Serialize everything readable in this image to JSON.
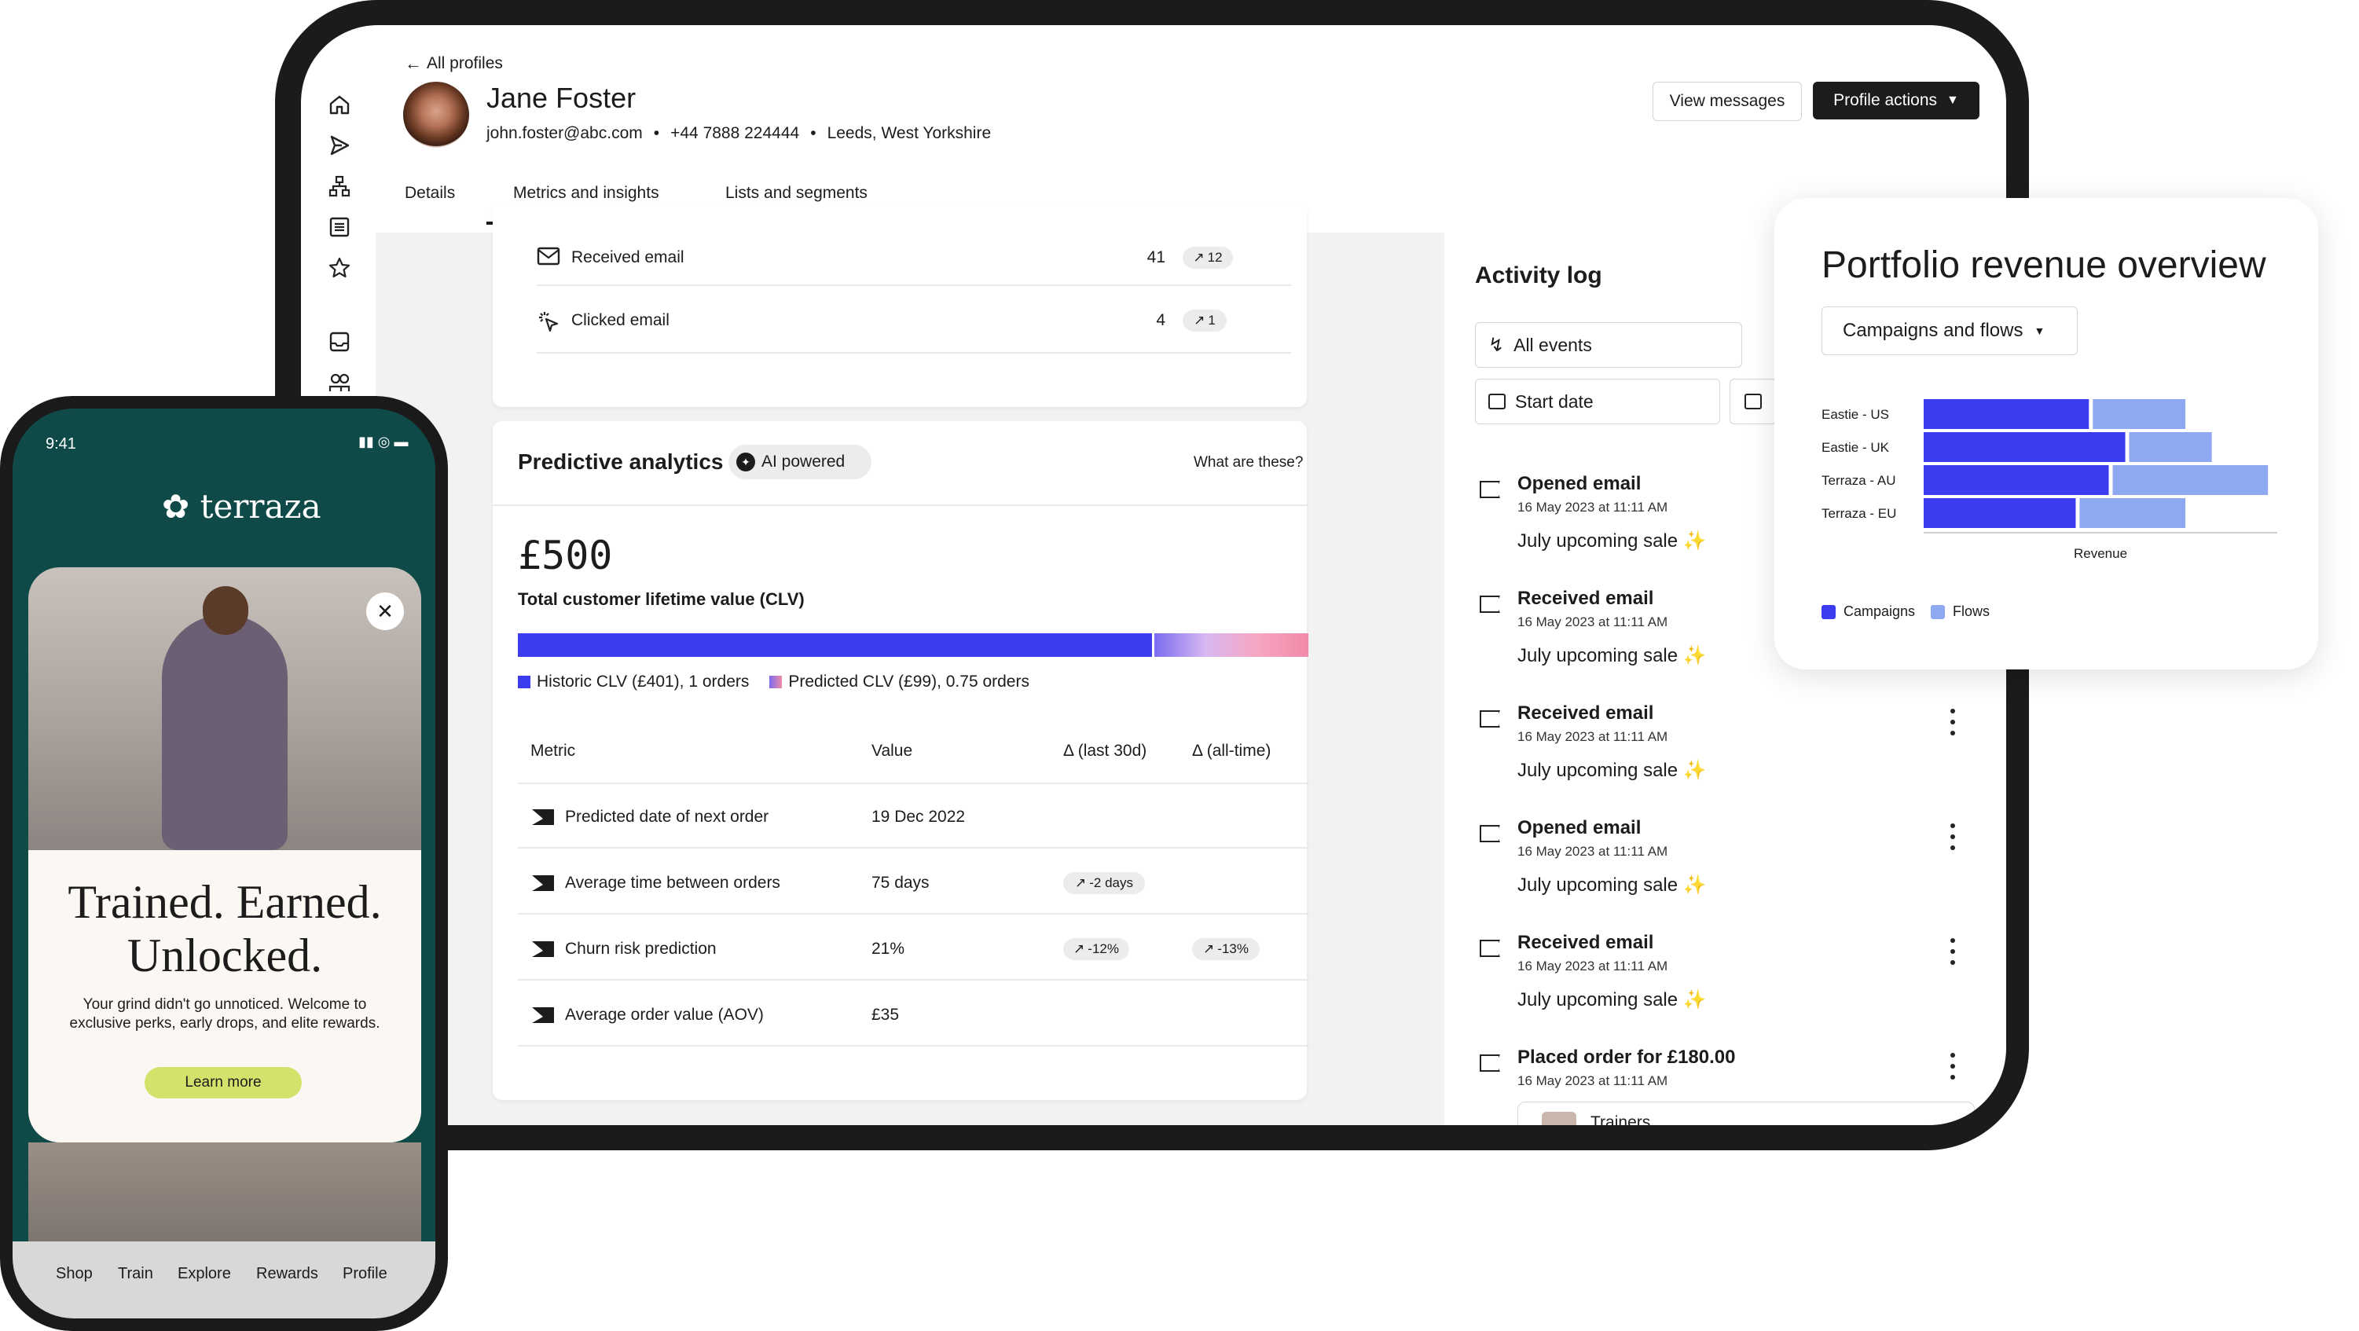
{
  "profile": {
    "back_label": "All profiles",
    "name": "Jane Foster",
    "email": "john.foster@abc.com",
    "phone": "+44 7888 224444",
    "location": "Leeds, West Yorkshire",
    "view_messages": "View messages",
    "profile_actions": "Profile actions",
    "separator": "•"
  },
  "tabs": [
    {
      "label": "Details",
      "active": false
    },
    {
      "label": "Metrics and insights",
      "active": true
    },
    {
      "label": "Lists and segments",
      "active": false
    }
  ],
  "email_metrics": [
    {
      "label": "Received email",
      "value": "41",
      "change": "12",
      "icon": "mail-icon"
    },
    {
      "label": "Clicked email",
      "value": "4",
      "change": "1",
      "icon": "click-icon"
    }
  ],
  "predictive": {
    "title": "Predictive analytics",
    "badge": "AI powered",
    "help_link": "What are these?",
    "clv_value": "£500",
    "clv_label": "Total customer lifetime value (CLV)",
    "historic_fraction": 0.802,
    "legend_historic": "Historic CLV (£401), 1 orders",
    "legend_predicted": "Predicted CLV (£99), 0.75 orders",
    "columns": [
      "Metric",
      "Value",
      "Δ (last 30d)",
      "Δ (all-time)"
    ],
    "rows": [
      {
        "metric": "Predicted date of next order",
        "value": "19 Dec 2022",
        "d30": "",
        "dall": ""
      },
      {
        "metric": "Average time between orders",
        "value": "75 days",
        "d30": "-2 days",
        "dall": ""
      },
      {
        "metric": "Churn risk prediction",
        "value": "21%",
        "d30": "-12%",
        "dall": "-13%"
      },
      {
        "metric": "Average order value (AOV)",
        "value": "£35",
        "d30": "",
        "dall": ""
      }
    ]
  },
  "activity": {
    "title": "Activity log",
    "filter_events": "All events",
    "filter_date": "Start date",
    "events": [
      {
        "title": "Opened email",
        "date": "16 May 2023 at 11:11 AM",
        "campaign": "July upcoming sale"
      },
      {
        "title": "Received email",
        "date": "16 May 2023 at 11:11 AM",
        "campaign": "July upcoming sale"
      },
      {
        "title": "Received email",
        "date": "16 May 2023 at 11:11 AM",
        "campaign": "July upcoming sale"
      },
      {
        "title": "Opened email",
        "date": "16 May 2023 at 11:11 AM",
        "campaign": "July upcoming sale"
      },
      {
        "title": "Received email",
        "date": "16 May 2023 at 11:11 AM",
        "campaign": "July upcoming sale"
      },
      {
        "title": "Placed order for £180.00",
        "date": "16 May 2023 at 11:11 AM",
        "campaign": ""
      }
    ],
    "order_item": "Trainers"
  },
  "chart_data": {
    "type": "bar",
    "orientation": "horizontal",
    "stacked": true,
    "title": "Portfolio revenue overview",
    "dropdown": "Campaigns and flows",
    "xlabel": "Revenue",
    "ylabel": "",
    "categories": [
      "Eastie - US",
      "Eastie - UK",
      "Terraza - AU",
      "Terraza - EU"
    ],
    "series": [
      {
        "name": "Campaigns",
        "color": "#3b3bef",
        "values": [
          50,
          61,
          56,
          46
        ]
      },
      {
        "name": "Flows",
        "color": "#8ea8f2",
        "values": [
          28,
          25,
          47,
          32
        ]
      }
    ],
    "xlim": [
      0,
      107
    ],
    "grid": false,
    "legend": "bottom-left"
  },
  "phone": {
    "time": "9:41",
    "brand": "terraza",
    "headline_1": "Trained. Earned.",
    "headline_2": "Unlocked.",
    "body_1": "Your grind didn't go unnoticed. Welcome to",
    "body_2": "exclusive perks, early drops, and elite rewards.",
    "cta": "Learn more",
    "nav": [
      "Shop",
      "Train",
      "Explore",
      "Rewards",
      "Profile"
    ]
  },
  "colors": {
    "accent_blue": "#3b3bef",
    "light_blue": "#8ea8f2",
    "phone_green": "#0f4a48",
    "cta_lime": "#d3e26b"
  }
}
